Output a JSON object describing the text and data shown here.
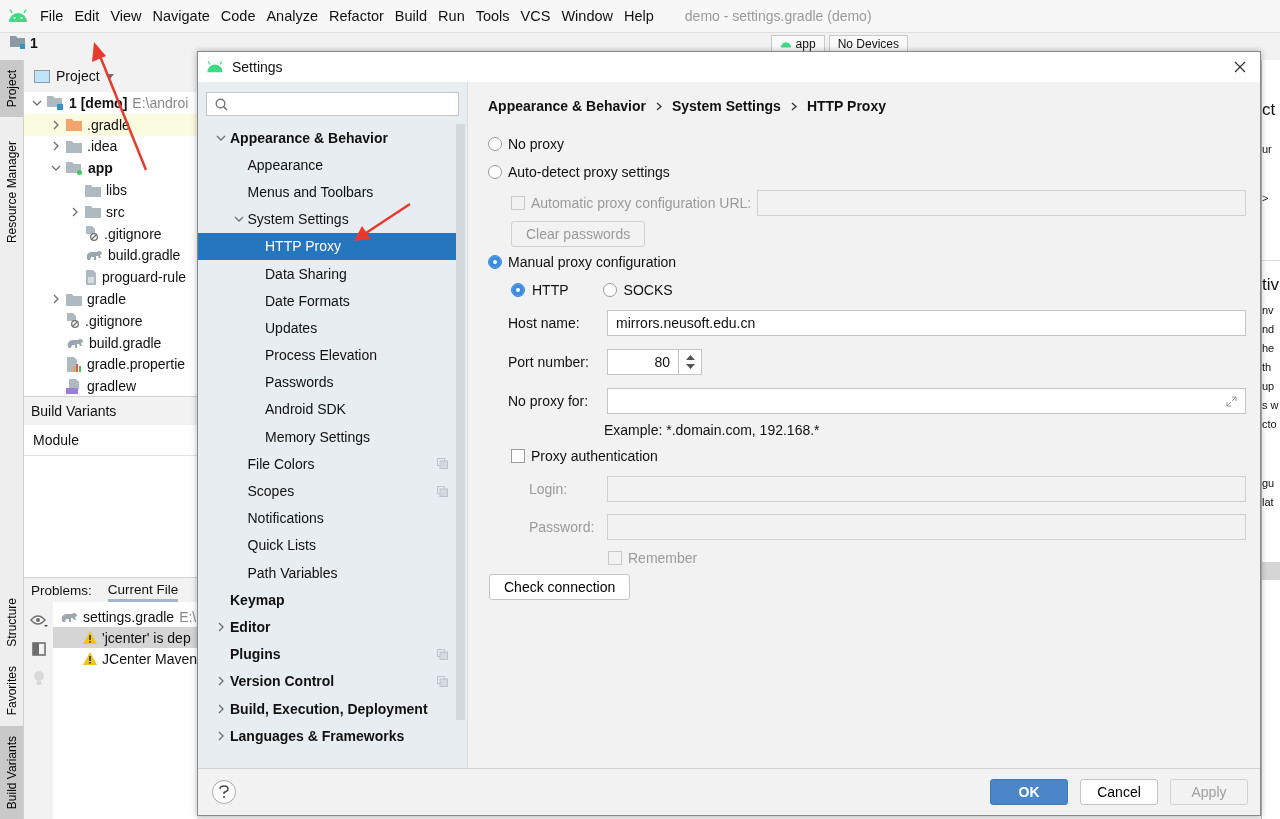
{
  "menu_bar": {
    "items": [
      "File",
      "Edit",
      "View",
      "Navigate",
      "Code",
      "Analyze",
      "Refactor",
      "Build",
      "Run",
      "Tools",
      "VCS",
      "Window",
      "Help"
    ],
    "title": "demo - settings.gradle (demo)"
  },
  "toolbar": {
    "project_number": "1",
    "run_config": "app",
    "device": "No Devices"
  },
  "tool_stripe": {
    "top": [
      {
        "label": "Project",
        "selected": true
      },
      {
        "label": "Resource Manager",
        "selected": false
      }
    ],
    "bottom": [
      {
        "label": "Structure",
        "selected": false
      },
      {
        "label": "Favorites",
        "selected": false
      },
      {
        "label": "Build Variants",
        "selected": true
      }
    ]
  },
  "project_panel": {
    "title": "Project",
    "tree": [
      {
        "label": "1 [demo]",
        "path": "E:\\androi",
        "kind": "project",
        "expanded": true,
        "highlighted": false,
        "children": [
          {
            "label": ".gradle",
            "kind": "excluded-folder",
            "expanded": false,
            "highlighted": true
          },
          {
            "label": ".idea",
            "kind": "folder",
            "expanded": false,
            "highlighted": false
          },
          {
            "label": "app",
            "kind": "module",
            "expanded": true,
            "highlighted": false,
            "children": [
              {
                "label": "libs",
                "kind": "folder",
                "highlighted": false
              },
              {
                "label": "src",
                "kind": "folder",
                "expanded": false,
                "highlighted": false
              },
              {
                "label": ".gitignore",
                "kind": "ignore-file",
                "highlighted": false
              },
              {
                "label": "build.gradle",
                "kind": "gradle-file",
                "highlighted": false
              },
              {
                "label": "proguard-rule",
                "kind": "text-file",
                "highlighted": false
              }
            ]
          },
          {
            "label": "gradle",
            "kind": "folder",
            "expanded": false,
            "highlighted": false
          },
          {
            "label": ".gitignore",
            "kind": "ignore-file",
            "highlighted": false
          },
          {
            "label": "build.gradle",
            "kind": "gradle-file",
            "highlighted": false
          },
          {
            "label": "gradle.propertie",
            "kind": "properties-file",
            "highlighted": false
          },
          {
            "label": "gradlew",
            "kind": "script-file",
            "highlighted": false
          }
        ]
      }
    ]
  },
  "build_variants": {
    "title": "Build Variants",
    "columns": [
      "Module"
    ]
  },
  "problems": {
    "label": "Problems:",
    "tabs": [
      {
        "label": "Current File",
        "selected": true
      }
    ],
    "file": {
      "name": "settings.gradle",
      "path": "E:\\"
    },
    "items": [
      {
        "text": "'jcenter' is dep",
        "selected": true
      },
      {
        "text": "JCenter Maven",
        "selected": false
      }
    ]
  },
  "editor": {
    "heading": "ct",
    "line": "ur",
    "crumb": ">",
    "heading_2": "tiv",
    "paragraph": [
      "nv",
      "nd",
      "he",
      "th",
      "up",
      "s w",
      "cto"
    ],
    "paragraph_2": [
      "gu",
      "lat"
    ]
  },
  "dialog": {
    "title": "Settings",
    "nav": [
      {
        "label": "Appearance & Behavior",
        "expanded": true,
        "selected": false,
        "project_level": false,
        "children": [
          {
            "label": "Appearance",
            "selected": false,
            "project_level": false
          },
          {
            "label": "Menus and Toolbars",
            "selected": false,
            "project_level": false
          },
          {
            "label": "System Settings",
            "expanded": true,
            "selected": false,
            "project_level": false,
            "children": [
              {
                "label": "HTTP Proxy",
                "selected": true,
                "project_level": false
              },
              {
                "label": "Data Sharing",
                "selected": false,
                "project_level": false
              },
              {
                "label": "Date Formats",
                "selected": false,
                "project_level": false
              },
              {
                "label": "Updates",
                "selected": false,
                "project_level": false
              },
              {
                "label": "Process Elevation",
                "selected": false,
                "project_level": false
              },
              {
                "label": "Passwords",
                "selected": false,
                "project_level": false
              },
              {
                "label": "Android SDK",
                "selected": false,
                "project_level": false
              },
              {
                "label": "Memory Settings",
                "selected": false,
                "project_level": false
              }
            ]
          },
          {
            "label": "File Colors",
            "selected": false,
            "project_level": true
          },
          {
            "label": "Scopes",
            "selected": false,
            "project_level": true
          },
          {
            "label": "Notifications",
            "selected": false,
            "project_level": false
          },
          {
            "label": "Quick Lists",
            "selected": false,
            "project_level": false
          },
          {
            "label": "Path Variables",
            "selected": false,
            "project_level": false
          }
        ]
      },
      {
        "label": "Keymap",
        "selected": false,
        "project_level": false
      },
      {
        "label": "Editor",
        "expanded": false,
        "selected": false,
        "project_level": false
      },
      {
        "label": "Plugins",
        "selected": false,
        "project_level": true
      },
      {
        "label": "Version Control",
        "expanded": false,
        "selected": false,
        "project_level": true
      },
      {
        "label": "Build, Execution, Deployment",
        "expanded": false,
        "selected": false,
        "project_level": false
      },
      {
        "label": "Languages & Frameworks",
        "expanded": false,
        "selected": false,
        "project_level": false
      }
    ],
    "breadcrumb": [
      "Appearance & Behavior",
      "System Settings",
      "HTTP Proxy"
    ],
    "no_proxy": {
      "label": "No proxy",
      "selected": false
    },
    "auto_detect": {
      "label": "Auto-detect proxy settings",
      "selected": false,
      "pac_url": {
        "label": "Automatic proxy configuration URL:",
        "checked": false
      },
      "clear_passwords": "Clear passwords"
    },
    "manual": {
      "label": "Manual proxy configuration",
      "selected": true,
      "protocols": [
        {
          "label": "HTTP",
          "selected": true
        },
        {
          "label": "SOCKS",
          "selected": false
        }
      ],
      "fields": [
        {
          "label": "Host name:",
          "value": "mirrors.neusoft.edu.cn",
          "kind": "text"
        },
        {
          "label": "Port number:",
          "value": "80",
          "kind": "spinner"
        },
        {
          "label": "No proxy for:",
          "kind": "expandable"
        }
      ],
      "example": "Example: *.domain.com, 192.168.*",
      "auth": {
        "label": "Proxy authentication",
        "checked": false,
        "fields": [
          {
            "label": "Login:"
          },
          {
            "label": "Password:"
          }
        ],
        "remember": {
          "label": "Remember",
          "checked": false
        }
      }
    },
    "check_button": "Check connection",
    "buttons": [
      {
        "label": "OK",
        "kind": "primary",
        "disabled": false
      },
      {
        "label": "Cancel",
        "kind": "normal",
        "disabled": false
      },
      {
        "label": "Apply",
        "kind": "normal",
        "disabled": true
      }
    ]
  }
}
